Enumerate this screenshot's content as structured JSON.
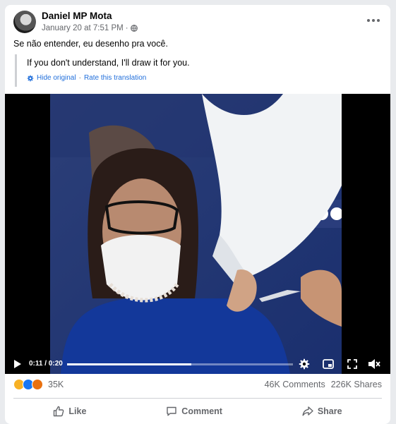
{
  "post": {
    "author": "Daniel MP Mota",
    "timestamp": "January 20 at 7:51 PM",
    "privacy_icon": "globe-icon",
    "text": "Se não entender, eu desenho pra você.",
    "translation": {
      "text": "If you don't understand, I'll draw it for you.",
      "hide_label": "Hide original",
      "separator": "·",
      "rate_label": "Rate this translation"
    }
  },
  "video": {
    "time": "0:11 / 0:20",
    "progress": 0.55
  },
  "stats": {
    "reactions": [
      "haha",
      "like",
      "angry"
    ],
    "reaction_count": "35K",
    "comments": "46K Comments",
    "shares": "226K Shares"
  },
  "actions": {
    "like_label": "Like",
    "comment_label": "Comment",
    "share_label": "Share"
  },
  "colors": {
    "link": "#216fdb",
    "muted": "#65676b",
    "like_blue": "#1877f2"
  }
}
